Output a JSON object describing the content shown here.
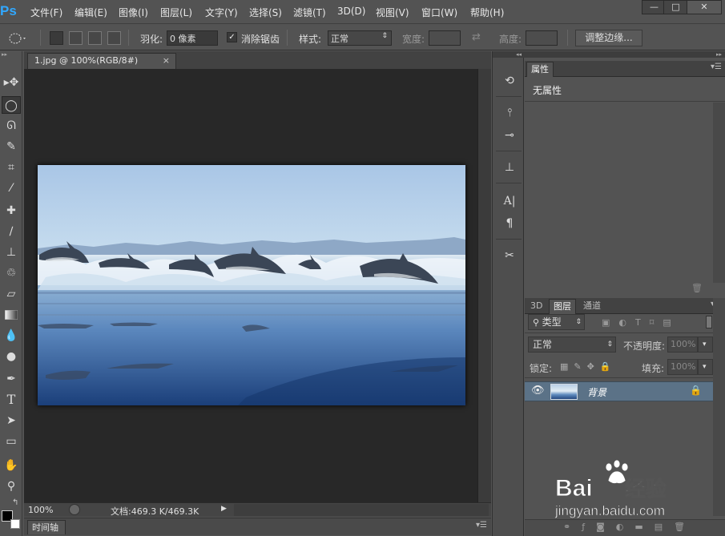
{
  "app": {
    "logo": "Ps"
  },
  "menu": [
    "文件(F)",
    "编辑(E)",
    "图像(I)",
    "图层(L)",
    "文字(Y)",
    "选择(S)",
    "滤镜(T)",
    "3D(D)",
    "视图(V)",
    "窗口(W)",
    "帮助(H)"
  ],
  "window_controls": {
    "minimize": "—",
    "maximize": "□",
    "close": "✕"
  },
  "options": {
    "feather_label": "羽化:",
    "feather_value": "0 像素",
    "antialias_label": "消除锯齿",
    "antialias_checked": true,
    "style_label": "样式:",
    "style_value": "正常",
    "width_label": "宽度:",
    "height_label": "高度:",
    "refine_button": "调整边缘..."
  },
  "document": {
    "tab_title": "1.jpg @ 100%(RGB/8#)",
    "tab_close": "×",
    "zoom": "100%",
    "doc_info": "文档:469.3 K/469.3K",
    "timeline_tab": "时间轴"
  },
  "properties_panel": {
    "tab": "属性",
    "content": "无属性"
  },
  "layers_panel": {
    "tabs": [
      "3D",
      "图层",
      "通道"
    ],
    "active_tab": "图层",
    "filter_kind": "类型",
    "blend_mode": "正常",
    "opacity_label": "不透明度:",
    "opacity_value": "100%",
    "lock_label": "锁定:",
    "fill_label": "填充:",
    "fill_value": "100%",
    "layers": [
      {
        "name": "背景",
        "visible": true,
        "locked": true
      }
    ]
  },
  "watermark": {
    "brand": "Bai",
    "brand2": "经验",
    "url": "jingyan.baidu.com"
  },
  "colors": {
    "ui_bg": "#535353",
    "canvas_bg": "#282828",
    "selected_layer": "#5b7287",
    "ps_blue": "#31a8ff"
  }
}
